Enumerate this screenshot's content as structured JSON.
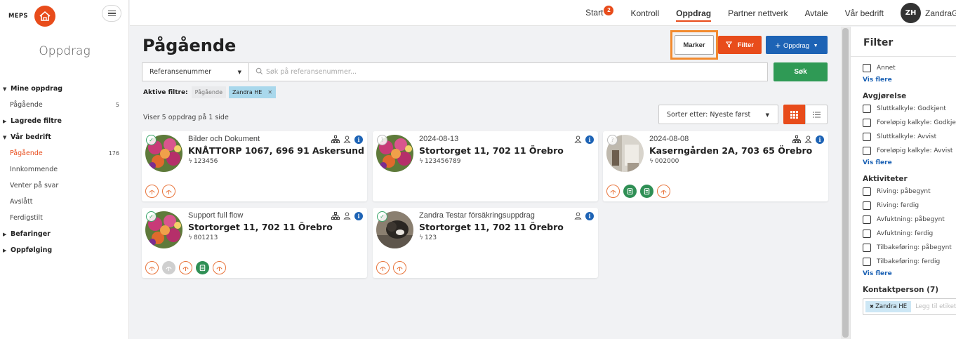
{
  "app": {
    "logo_text": "MEPS"
  },
  "sidebar": {
    "title": "Oppdrag",
    "items": [
      {
        "label": "Mine oppdrag",
        "type": "group",
        "expanded": true
      },
      {
        "label": "Pågående",
        "count": "5"
      },
      {
        "label": "Lagrede filtre",
        "type": "group",
        "expanded": false
      },
      {
        "label": "Vår bedrift",
        "type": "group",
        "expanded": true
      },
      {
        "label": "Pågående",
        "count": "176",
        "active": true
      },
      {
        "label": "Innkommende"
      },
      {
        "label": "Venter på svar"
      },
      {
        "label": "Avslått"
      },
      {
        "label": "Ferdigstilt"
      },
      {
        "label": "Befaringer",
        "type": "group",
        "expanded": false
      },
      {
        "label": "Oppfølging",
        "type": "group",
        "expanded": false
      }
    ]
  },
  "topnav": {
    "items": [
      {
        "label": "Start",
        "badge": "2"
      },
      {
        "label": "Kontroll"
      },
      {
        "label": "Oppdrag",
        "active": true
      },
      {
        "label": "Partner nettverk"
      },
      {
        "label": "Avtale"
      },
      {
        "label": "Vår bedrift"
      }
    ],
    "user_initials": "ZH",
    "user_name": "ZandraG"
  },
  "main": {
    "title": "Pågående",
    "marker_label": "Marker",
    "filter_label": "Filter",
    "oppdrag_label": "Oppdrag",
    "search": {
      "field_select": "Referansenummer",
      "placeholder": "Søk på referansenummer...",
      "button": "Søk"
    },
    "active_filters_label": "Aktive filtre:",
    "active_filters": [
      "Pågående",
      "Zandra HE"
    ],
    "result_text": "Viser 5 oppdrag på 1 side",
    "sort_label": "Sorter etter: Nyeste først",
    "cards": [
      {
        "subtitle": "Bilder och Dokument",
        "title": "KNÅTTORP 1067, 696 91 Askersund",
        "ref": "123456",
        "thumb": "flowers",
        "checked": true,
        "org_icon": true,
        "statuses": [
          "orange",
          "orange"
        ]
      },
      {
        "subtitle": "2024-08-13",
        "title": "Stortorget 11, 702 11 Örebro",
        "ref": "123456789",
        "thumb": "flowers",
        "checked": false,
        "org_icon": false,
        "statuses": []
      },
      {
        "subtitle": "2024-08-08",
        "title": "Kaserngården 2A, 703 65 Örebro",
        "ref": "002000",
        "thumb": "room",
        "checked": false,
        "org_icon": true,
        "statuses": [
          "orange",
          "green",
          "green",
          "orange"
        ]
      },
      {
        "subtitle": "Support full flow",
        "title": "Stortorget 11, 702 11 Örebro",
        "ref": "801213",
        "thumb": "flowers",
        "checked": true,
        "org_icon": true,
        "statuses": [
          "orange",
          "gray",
          "orange",
          "green",
          "orange"
        ]
      },
      {
        "subtitle": "Zandra Testar försäkringsuppdrag",
        "title": "Stortorget 11, 702 11 Örebro",
        "ref": "123",
        "thumb": "dog",
        "checked": true,
        "org_icon": false,
        "statuses": [
          "orange",
          "orange"
        ]
      }
    ]
  },
  "filter_panel": {
    "title": "Filter",
    "sections": [
      {
        "heading": "",
        "options": [
          "Annet"
        ],
        "more": "Vis flere"
      },
      {
        "heading": "Avgjørelse",
        "options": [
          "Sluttkalkyle: Godkjent",
          "Foreløpig kalkyle: Godkjent",
          "Sluttkalkyle: Avvist",
          "Foreløpig kalkyle: Avvist"
        ],
        "more": "Vis flere"
      },
      {
        "heading": "Aktiviteter",
        "options": [
          "Riving: påbegynt",
          "Riving: ferdig",
          "Avfuktning: påbegynt",
          "Avfuktning: ferdig",
          "Tilbakeføring: påbegynt",
          "Tilbakeføring: ferdig"
        ],
        "more": "Vis flere"
      }
    ],
    "contact_heading": "Kontaktperson (7)",
    "contact_tag": "Zandra HE",
    "contact_placeholder": "Legg til etikett"
  },
  "colors": {
    "accent": "#e84c1b",
    "primary": "#1d63b5",
    "success": "#2f9a55"
  }
}
